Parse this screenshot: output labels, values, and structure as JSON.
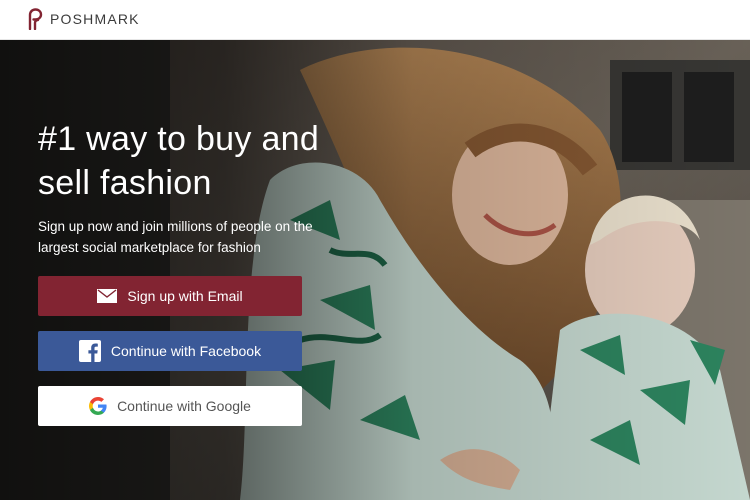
{
  "header": {
    "brand": "POSHMARK",
    "logo_icon": "poshmark-logo-icon",
    "brand_color": "#822432"
  },
  "hero": {
    "headline": "#1 way to buy and sell fashion",
    "subtext": "Sign up now and join millions of people on the largest social marketplace for fashion"
  },
  "buttons": {
    "email": {
      "label": "Sign up with Email",
      "icon": "envelope-icon",
      "color": "#822432"
    },
    "facebook": {
      "label": "Continue with Facebook",
      "icon": "facebook-icon",
      "color": "#3b5998"
    },
    "google": {
      "label": "Continue with Google",
      "icon": "google-icon",
      "color": "#ffffff"
    }
  }
}
